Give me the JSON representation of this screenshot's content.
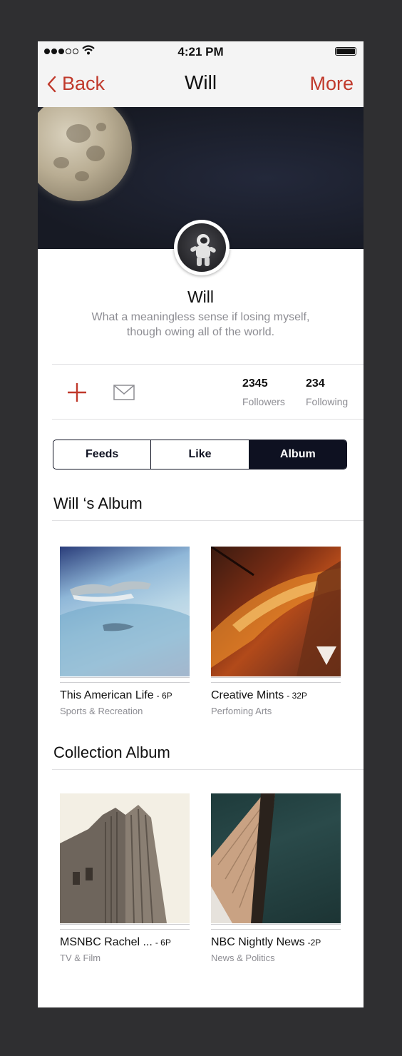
{
  "status_bar": {
    "time": "4:21 PM",
    "signal_bars": 5,
    "signal_filled": 3,
    "battery_level": 1.0
  },
  "nav": {
    "back_label": "Back",
    "title": "Will",
    "more_label": "More"
  },
  "profile": {
    "name": "Will",
    "bio_line1": "What a meaningless sense if losing myself,",
    "bio_line2": "though owing all of the world."
  },
  "stats": {
    "followers_count": "2345",
    "followers_label": "Followers",
    "following_count": "234",
    "following_label": "Following"
  },
  "tabs": {
    "items": [
      "Feeds",
      "Like",
      "Album"
    ],
    "selected": "Album"
  },
  "sections": {
    "album_title": "Will ‘s Album",
    "collection_title": "Collection Album"
  },
  "albums": [
    {
      "title": "This American Life",
      "count": "- 6P",
      "category": "Sports & Recreation"
    },
    {
      "title": "Creative Mints",
      "count": "- 32P",
      "category": "Perfoming Arts"
    }
  ],
  "collection": [
    {
      "title": "MSNBC Rachel ...",
      "count": "- 6P",
      "category": "TV & Film"
    },
    {
      "title": "NBC Nightly News",
      "count": "-2P",
      "category": "News & Politics"
    }
  ],
  "colors": {
    "accent": "#c0392b",
    "dark": "#0e1121",
    "muted": "#8d8d93",
    "background": "#2f2f31"
  }
}
